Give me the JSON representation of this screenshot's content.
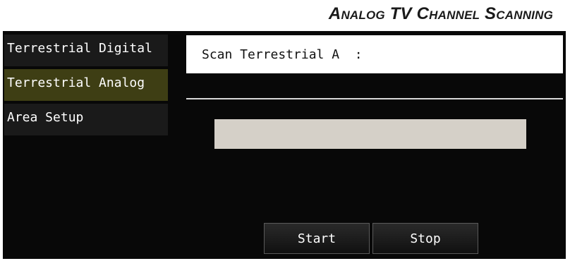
{
  "document": {
    "title": "Analog TV Channel Scanning"
  },
  "sidebar": {
    "items": [
      {
        "label": "Terrestrial Digital",
        "active": false
      },
      {
        "label": "Terrestrial Analog",
        "active": true
      },
      {
        "label": "Area Setup",
        "active": false
      }
    ]
  },
  "scan": {
    "status_label": "Scan Terrestrial A  :",
    "progress": 0
  },
  "buttons": {
    "start": "Start",
    "stop": "Stop"
  },
  "colors": {
    "active_item_bg": "#3e3e14",
    "inactive_item_bg": "#1a1a1a",
    "screen_bg": "#080808",
    "progress_track": "#d5d0c8"
  }
}
